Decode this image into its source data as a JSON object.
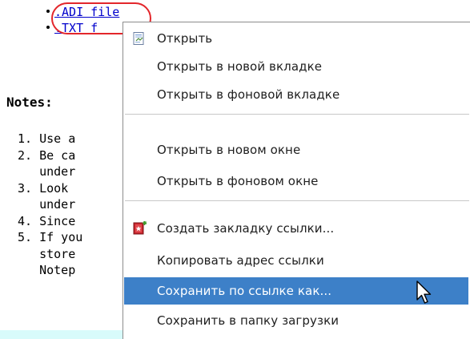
{
  "page": {
    "links": [
      {
        "text": ".ADI file"
      },
      {
        "text": ".TXT f"
      }
    ],
    "notes_title": "Notes:",
    "notes_lines": [
      "1. Use a",
      "2. Be ca",
      "   under",
      "3. Look ",
      "   under",
      "4. Since",
      "5. If you",
      "   store",
      "   Notep"
    ]
  },
  "context_menu": {
    "items": [
      {
        "label": "Открыть",
        "icon": "open-page-icon"
      },
      {
        "label": "Открыть в новой вкладке"
      },
      {
        "label": "Открыть в фоновой вкладке"
      },
      {
        "label": "Открыть в новом окне"
      },
      {
        "label": "Открыть в фоновом окне"
      },
      {
        "label": "Создать закладку ссылки...",
        "icon": "bookmark-icon"
      },
      {
        "label": "Копировать адрес ссылки"
      },
      {
        "label": "Сохранить по ссылке как...",
        "highlighted": true
      },
      {
        "label": "Сохранить в папку загрузки"
      }
    ]
  },
  "colors": {
    "link": "#0000cc",
    "highlight_circle": "#e3262b",
    "menu_highlight": "#3d80c8",
    "teal_bar": "#d8fbfb"
  }
}
